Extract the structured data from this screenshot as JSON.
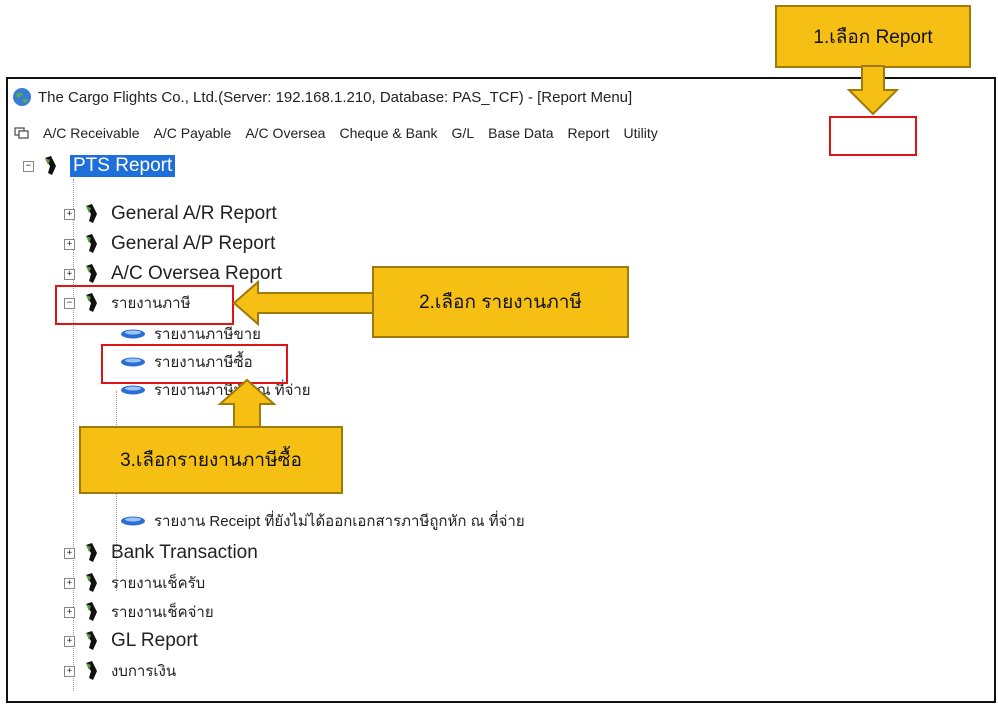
{
  "window": {
    "title": "The Cargo Flights Co., Ltd.(Server: 192.168.1.210,  Database: PAS_TCF) - [Report Menu]"
  },
  "menu": [
    {
      "label": "A/C Receivable"
    },
    {
      "label": "A/C Payable"
    },
    {
      "label": "A/C Oversea"
    },
    {
      "label": "Cheque & Bank"
    },
    {
      "label": "G/L"
    },
    {
      "label": "Base Data"
    },
    {
      "label": "Report"
    },
    {
      "label": "Utility"
    }
  ],
  "tree": {
    "root": "PTS Report",
    "groups": [
      {
        "label": "General A/R Report"
      },
      {
        "label": "General A/P Report"
      },
      {
        "label": "A/C Oversea Report"
      },
      {
        "label": "รายงานภาษี"
      },
      {
        "label": "Bank Transaction"
      },
      {
        "label": "รายงานเช็ครับ"
      },
      {
        "label": "รายงานเช็คจ่าย"
      },
      {
        "label": "GL Report"
      },
      {
        "label": "งบการเงิน"
      }
    ],
    "tax_children": [
      {
        "label": "รายงานภาษีขาย"
      },
      {
        "label": "รายงานภาษีซื้อ"
      },
      {
        "label": "รายงานภาษีหัก ณ ที่จ่าย"
      },
      {
        "label": "รายงาน Receipt ที่ยังไม่ได้ออกเอกสารภาษีถูกหัก ณ ที่จ่าย"
      }
    ]
  },
  "callouts": {
    "step1": "1.เลือก Report",
    "step2": "2.เลือก  รายงานภาษี",
    "step3": "3.เลือกรายงานภาษีซื้อ"
  },
  "colors": {
    "callout_fill": "#f5bf14",
    "highlight_box": "#e01414",
    "selection": "#1e6fd9"
  }
}
